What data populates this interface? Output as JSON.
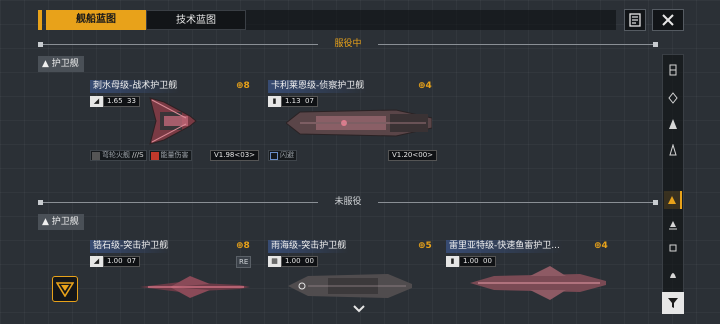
{
  "tabs": [
    {
      "label": "舰船蓝图",
      "active": true
    },
    {
      "label": "技术蓝图",
      "active": false
    }
  ],
  "colors": {
    "accent": "#e8a21a",
    "panel": "#121518",
    "title_bg": "#3a5282"
  },
  "sections": [
    {
      "label": "服役中",
      "category": "▲ 护卫舰"
    },
    {
      "label": "未服役",
      "category": "▲ 护卫舰"
    }
  ],
  "in_service": [
    {
      "title": "刺水母级-战术护卫舰",
      "cost": "8",
      "level_value": "1.65",
      "level_sub": "33",
      "perks": [
        "弯轮火舰",
        "能量伤害"
      ],
      "version": "V1.98<03>",
      "ship_color": "#7a3a44"
    },
    {
      "title": "卡利莱恩级-侦察护卫舰",
      "cost": "4",
      "level_value": "1.13",
      "level_sub": "07",
      "perks": [
        "闪避"
      ],
      "version": "V1.20<00>",
      "ship_color": "#5a4548"
    }
  ],
  "not_in_service": [
    {
      "title": "锆石级-突击护卫舰",
      "cost": "8",
      "level_value": "1.00",
      "level_sub": "07",
      "tag": "RE",
      "ship_color": "#6a3a46"
    },
    {
      "title": "雨海级-突击护卫舰",
      "cost": "5",
      "level_value": "1.00",
      "level_sub": "00",
      "ship_color": "#504c4e"
    },
    {
      "title": "雷里亚特级-快速鱼雷护卫...",
      "cost": "4",
      "level_value": "1.00",
      "level_sub": "00",
      "ship_color": "#7a4a54"
    }
  ],
  "filters": [
    {
      "icon": "carrier-icon",
      "selected": false
    },
    {
      "icon": "battleship-icon",
      "selected": false
    },
    {
      "icon": "cruiser-icon",
      "selected": false
    },
    {
      "icon": "destroyer-icon",
      "selected": false
    },
    {
      "icon": "frigate-icon",
      "selected": true
    },
    {
      "icon": "corvette-icon",
      "selected": false
    },
    {
      "icon": "auxiliary-icon",
      "selected": false
    },
    {
      "icon": "fighter-icon",
      "selected": false
    }
  ]
}
